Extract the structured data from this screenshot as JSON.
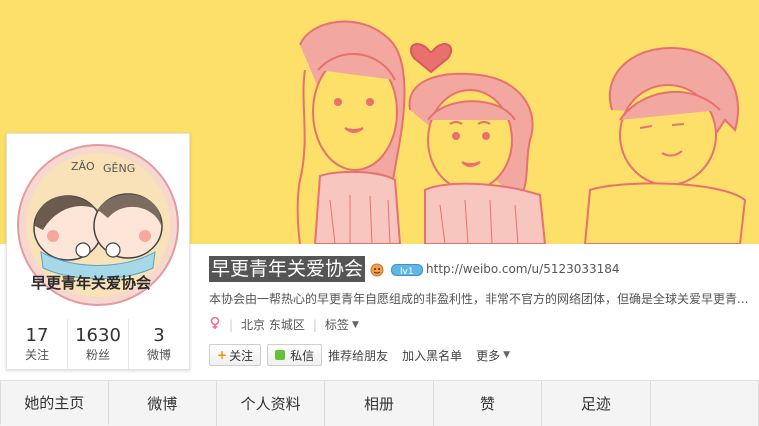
{
  "profile": {
    "name": "早更青年关爱协会",
    "url": "http://weibo.com/u/5123033184",
    "bio": "本协会由一帮热心的早更青年自愿组成的非盈利性，非常不官方的网络团体，但确是全球关爱早更青...",
    "location": "北京 东城区",
    "tags_label": "标签",
    "badge_text": "lv1",
    "avatar_text": {
      "top_pinyin_1": "ZǍO",
      "top_pinyin_2": "GĒNG",
      "bottom": "早更青年关爱协会"
    }
  },
  "stats": [
    {
      "num": "17",
      "label": "关注"
    },
    {
      "num": "1630",
      "label": "粉丝"
    },
    {
      "num": "3",
      "label": "微博"
    }
  ],
  "actions": {
    "follow": "关注",
    "message": "私信",
    "recommend": "推荐给朋友",
    "blacklist": "加入黑名单",
    "more": "更多"
  },
  "tabs": [
    "她的主页",
    "微博",
    "个人资料",
    "相册",
    "赞",
    "足迹",
    ""
  ],
  "colors": {
    "cover_bg": "#fce06a",
    "illustration_line": "#e8716f",
    "follow_plus": "#f29100",
    "message_dot": "#65c23a"
  }
}
